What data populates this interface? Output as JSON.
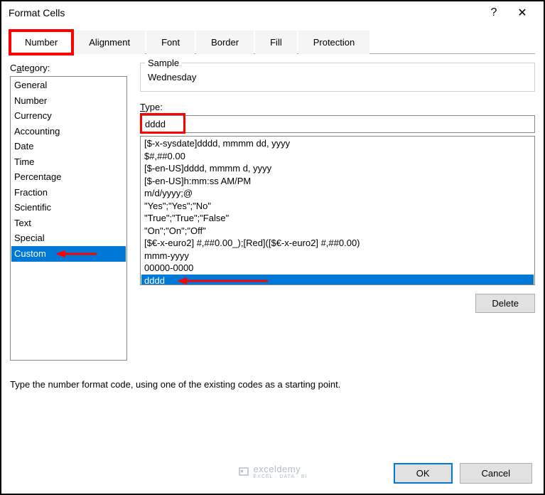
{
  "titlebar": {
    "title": "Format Cells",
    "help": "?",
    "close": "✕"
  },
  "tabs": [
    "Number",
    "Alignment",
    "Font",
    "Border",
    "Fill",
    "Protection"
  ],
  "category": {
    "label_pre": "C",
    "label_u": "a",
    "label_post": "tegory:",
    "items": [
      "General",
      "Number",
      "Currency",
      "Accounting",
      "Date",
      "Time",
      "Percentage",
      "Fraction",
      "Scientific",
      "Text",
      "Special",
      "Custom"
    ],
    "selected": 11
  },
  "sample": {
    "label": "Sample",
    "value": "Wednesday"
  },
  "type": {
    "label_u": "T",
    "label_post": "ype:",
    "value": "dddd"
  },
  "formats": {
    "items": [
      "[$-x-sysdate]dddd, mmmm dd, yyyy",
      "$#,##0.00",
      "[$-en-US]dddd, mmmm d, yyyy",
      "[$-en-US]h:mm:ss AM/PM",
      "m/d/yyyy;@",
      "\"Yes\";\"Yes\";\"No\"",
      "\"True\";\"True\";\"False\"",
      "\"On\";\"On\";\"Off\"",
      "[$€-x-euro2] #,##0.00_);[Red]([$€-x-euro2] #,##0.00)",
      "mmm-yyyy",
      "00000-0000",
      "dddd"
    ],
    "selected": 11
  },
  "buttons": {
    "delete_u": "D",
    "delete_post": "elete",
    "ok": "OK",
    "cancel": "Cancel"
  },
  "help_text": "Type the number format code, using one of the existing codes as a starting point.",
  "watermark": {
    "brand": "exceldemy",
    "tagline": "EXCEL · DATA · BI"
  }
}
